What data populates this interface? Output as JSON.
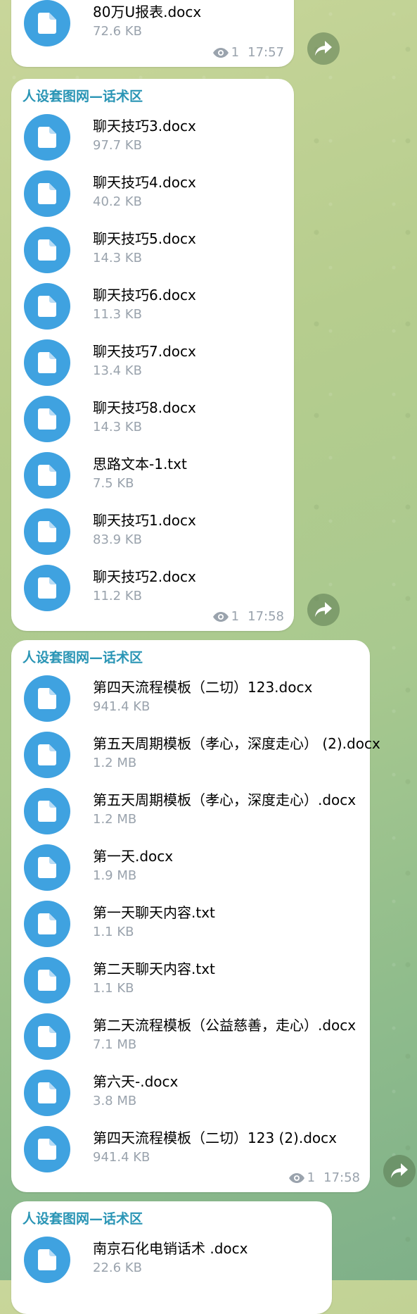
{
  "messages": [
    {
      "sender": "",
      "files": [
        {
          "name": "80万U报表.docx",
          "size": "72.6 KB"
        }
      ],
      "views": "1",
      "time": "17:57"
    },
    {
      "sender": "人设套图网—话术区",
      "files": [
        {
          "name": "聊天技巧3.docx",
          "size": "97.7 KB"
        },
        {
          "name": "聊天技巧4.docx",
          "size": "40.2 KB"
        },
        {
          "name": "聊天技巧5.docx",
          "size": "14.3 KB"
        },
        {
          "name": "聊天技巧6.docx",
          "size": "11.3 KB"
        },
        {
          "name": "聊天技巧7.docx",
          "size": "13.4 KB"
        },
        {
          "name": "聊天技巧8.docx",
          "size": "14.3 KB"
        },
        {
          "name": "思路文本-1.txt",
          "size": "7.5 KB"
        },
        {
          "name": "聊天技巧1.docx",
          "size": "83.9 KB"
        },
        {
          "name": "聊天技巧2.docx",
          "size": "11.2 KB"
        }
      ],
      "views": "1",
      "time": "17:58"
    },
    {
      "sender": "人设套图网—话术区",
      "files": [
        {
          "name": "第四天流程模板（二切）123.docx",
          "size": "941.4 KB"
        },
        {
          "name": "第五天周期模板（孝心，深度走心） (2).docx",
          "size": "1.2 MB"
        },
        {
          "name": "第五天周期模板（孝心，深度走心）.docx",
          "size": "1.2 MB"
        },
        {
          "name": "第一天.docx",
          "size": "1.9 MB"
        },
        {
          "name": "第一天聊天内容.txt",
          "size": "1.1 KB"
        },
        {
          "name": "第二天聊天内容.txt",
          "size": "1.1 KB"
        },
        {
          "name": "第二天流程模板（公益慈善，走心）.docx",
          "size": "7.1 MB"
        },
        {
          "name": "第六天-.docx",
          "size": "3.8 MB"
        },
        {
          "name": "第四天流程模板（二切）123 (2).docx",
          "size": "941.4 KB"
        }
      ],
      "views": "1",
      "time": "17:58"
    },
    {
      "sender": "人设套图网—话术区",
      "files": [
        {
          "name": "南京石化电销话术 .docx",
          "size": "22.6 KB"
        }
      ],
      "views": "",
      "time": ""
    }
  ],
  "icons": {
    "file": "document-icon",
    "views": "eye-icon",
    "forward": "forward-arrow-icon"
  },
  "colors": {
    "sender": "#2a95b5",
    "file_icon_bg": "#3fa2e0",
    "bubble": "#ffffff",
    "meta_text": "#9aa3ad"
  }
}
